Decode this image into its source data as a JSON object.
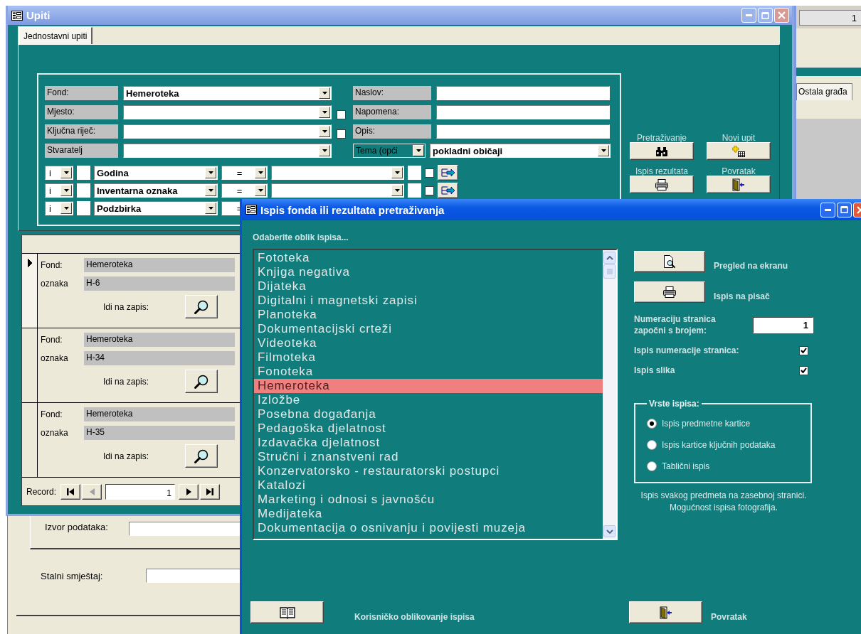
{
  "background_form": {
    "fields": [
      {
        "label": "Izvor podataka:"
      },
      {
        "label": "Stalni smještaj:"
      }
    ]
  },
  "background_window": {
    "field_value": "1",
    "tab": "Ostala građa"
  },
  "query_window": {
    "title": "Upiti",
    "tabs": [
      {
        "label": "Jednostavni upiti",
        "selected": true
      }
    ],
    "fields": [
      {
        "label": "Fond:",
        "value": "Hemeroteka"
      },
      {
        "label": "Mjesto:",
        "checked": false
      },
      {
        "label": "Ključna riječ:",
        "checked": false
      },
      {
        "label": "Stvaratelj"
      }
    ],
    "text_fields": [
      {
        "label": "Naslov:"
      },
      {
        "label": "Napomena:"
      },
      {
        "label": "Opis:"
      }
    ],
    "topic": {
      "label": "Tema (opći",
      "value": "pokladni običaji"
    },
    "criteria": [
      {
        "conjunction": "i",
        "field": "Godina",
        "operator": "=",
        "checked": false
      },
      {
        "conjunction": "i",
        "field": "Inventarna oznaka",
        "operator": "=",
        "checked": false
      },
      {
        "conjunction": "i",
        "field": "Podzbirka",
        "operator": "="
      }
    ],
    "actions": [
      {
        "label": "Pretraživanje",
        "kind": "search"
      },
      {
        "label": "Novi upit",
        "kind": "new"
      },
      {
        "label": "Ispis rezultata",
        "kind": "print"
      },
      {
        "label": "Povratak",
        "kind": "exit"
      }
    ],
    "records": [
      {
        "fond_label": "Fond:",
        "fond": "Hemeroteka",
        "code_label": "oznaka",
        "code": "H-6",
        "goto_label": "Idi na zapis:",
        "current": true
      },
      {
        "fond_label": "Fond:",
        "fond": "Hemeroteka",
        "code_label": "oznaka",
        "code": "H-34",
        "goto_label": "Idi na zapis:",
        "current": false
      },
      {
        "fond_label": "Fond:",
        "fond": "Hemeroteka",
        "code_label": "oznaka",
        "code": "H-35",
        "goto_label": "Idi na zapis:",
        "current": false
      }
    ],
    "navigator": {
      "label": "Record:",
      "value": "1"
    }
  },
  "print_dialog": {
    "title": "Ispis fonda ili rezultata pretraživanja",
    "prompt": "Odaberite oblik ispisa...",
    "reports": [
      {
        "label": "Fototeka",
        "selected": false
      },
      {
        "label": "Knjiga negativa",
        "selected": false
      },
      {
        "label": "Dijateka",
        "selected": false
      },
      {
        "label": "Digitalni i magnetski zapisi",
        "selected": false
      },
      {
        "label": "Planoteka",
        "selected": false
      },
      {
        "label": "Dokumentacijski crteži",
        "selected": false
      },
      {
        "label": "Videoteka",
        "selected": false
      },
      {
        "label": "Filmoteka",
        "selected": false
      },
      {
        "label": "Fonoteka",
        "selected": false
      },
      {
        "label": "Hemeroteka",
        "selected": true
      },
      {
        "label": "Izložbe",
        "selected": false
      },
      {
        "label": "Posebna događanja",
        "selected": false
      },
      {
        "label": "Pedagoška djelatnost",
        "selected": false
      },
      {
        "label": "Izdavačka djelatnost",
        "selected": false
      },
      {
        "label": "Stručni i znanstveni rad",
        "selected": false
      },
      {
        "label": "Konzervatorsko - restauratorski postupci",
        "selected": false
      },
      {
        "label": "Katalozi",
        "selected": false
      },
      {
        "label": "Marketing i odnosi s javnošću",
        "selected": false
      },
      {
        "label": "Medijateka",
        "selected": false
      },
      {
        "label": "Dokumentacija o osnivanju i povijesti muzeja",
        "selected": false
      }
    ],
    "outputs": [
      {
        "label": "Pregled na ekranu",
        "kind": "preview"
      },
      {
        "label": "Ispis na pisač",
        "kind": "print"
      }
    ],
    "start_page": {
      "label": "Numeraciju stranica započni s brojem:",
      "value": "1"
    },
    "options": [
      {
        "label": "Ispis numeracije stranica:",
        "checked": true
      },
      {
        "label": "Ispis slika",
        "checked": true
      }
    ],
    "layout_group": {
      "title": "Vrste ispisa:",
      "choices": [
        {
          "label": "Ispis predmetne kartice",
          "selected": true
        },
        {
          "label": "Ispis kartice ključnih podataka",
          "selected": false
        },
        {
          "label": "Tablični ispis",
          "selected": false
        }
      ]
    },
    "description": "Ispis svakog predmeta na zasebnoj stranici. Mogućnost ispisa fotografija.",
    "footer": [
      {
        "label": "Korisničko oblikovanje ispisa",
        "kind": "book"
      },
      {
        "label": "Povratak",
        "kind": "exit"
      }
    ]
  }
}
